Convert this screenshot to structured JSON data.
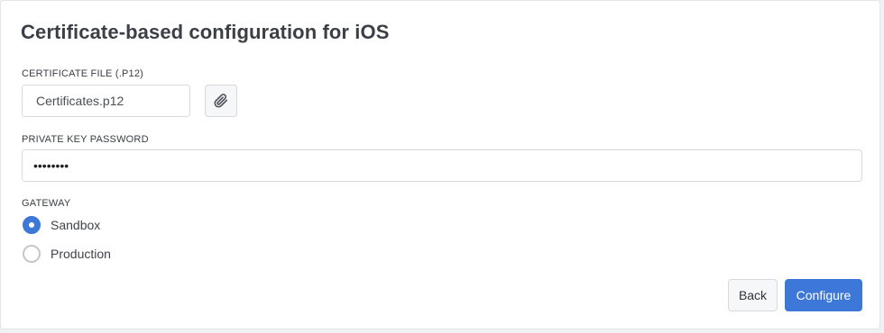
{
  "title": "Certificate-based configuration for iOS",
  "certificate": {
    "label": "CERTIFICATE FILE (.P12)",
    "value": "Certificates.p12",
    "attach_icon": "paperclip-icon"
  },
  "password": {
    "label": "PRIVATE KEY PASSWORD",
    "value": "••••••••"
  },
  "gateway": {
    "label": "GATEWAY",
    "selected": "Sandbox",
    "options": [
      {
        "label": "Sandbox",
        "checked": true
      },
      {
        "label": "Production",
        "checked": false
      }
    ]
  },
  "actions": {
    "back_label": "Back",
    "configure_label": "Configure"
  },
  "colors": {
    "accent": "#3d78d8",
    "border": "#d6d9de",
    "secondary_button_bg": "#f6f7f9"
  }
}
